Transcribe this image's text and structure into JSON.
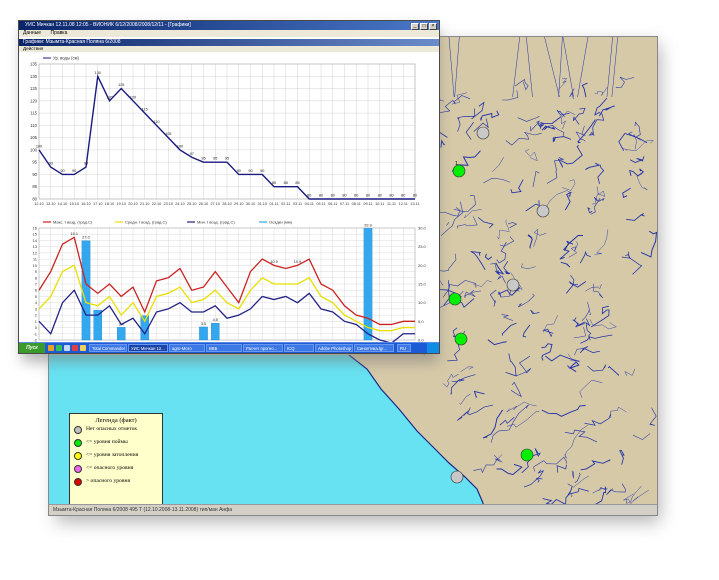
{
  "window": {
    "title": "УИС Мичкан 12.11.08 12:05 - ВИОНИК 6/12/2008/2008/12/11 - [Графики]",
    "menu": [
      "Данные",
      "Правка"
    ],
    "inner_title": "Графики: Мзымта-Красная Поляна 6/2008",
    "inner_menu": "Действия"
  },
  "legend": {
    "title": "Легенда (факт)",
    "items": [
      {
        "label": "Нет опасных отметок",
        "color": "#c0c0c0"
      },
      {
        "label": "<= уровня поймы",
        "color": "#00ee00"
      },
      {
        "label": "<= уровня затопления",
        "color": "#ffff00"
      },
      {
        "label": "<= опасного уровня",
        "color": "#ee66ee"
      },
      {
        "label": "> опасного уровня",
        "color": "#dd0000"
      }
    ]
  },
  "map_status": "Мзымта-Красная Поляна 6/2008 495 Т (12.10.2008-13.11.2008) тип/ман Анфа",
  "taskbar": {
    "start": "Пуск",
    "tasks": [
      "Total Commander",
      "УИС Мичкан 12...",
      "agro-Мото",
      "ВВБ",
      "Расчет прогно...",
      "ICQ",
      "Adobe Photoshop",
      "Синоптика.lgr...",
      "RU"
    ]
  },
  "colors": {
    "map_land": "#d6c9a8",
    "map_sea": "#66e2f2",
    "river": "#2233aa",
    "max_temp": "#cc2222",
    "mean_temp": "#e8e000",
    "min_temp": "#222288",
    "precip": "#33a8ee",
    "water_level": "#1a1a80"
  },
  "chart_data": [
    {
      "type": "line",
      "legend": [
        "Ур. воды (см)"
      ],
      "x": [
        "12.10",
        "13.10",
        "14.10",
        "15.10",
        "16.10",
        "17.10",
        "18.10",
        "19.10",
        "20.10",
        "21.10",
        "22.10",
        "23.10",
        "24.10",
        "25.10",
        "26.10",
        "27.10",
        "28.10",
        "29.10",
        "30.10",
        "31.10",
        "01.11",
        "02.11",
        "03.11",
        "04.11",
        "05.11",
        "06.11",
        "07.11",
        "08.11",
        "09.11",
        "10.11",
        "11.11",
        "12.11",
        "13.11"
      ],
      "ylim": [
        80,
        135
      ],
      "yticks": [
        80,
        85,
        90,
        95,
        100,
        105,
        110,
        115,
        120,
        125,
        130,
        135
      ],
      "series": [
        {
          "name": "Ур. воды (см)",
          "values": [
            100,
            93,
            90,
            90,
            93,
            130,
            120,
            125,
            120,
            115,
            110,
            105,
            100,
            97,
            95,
            95,
            95,
            90,
            90,
            90,
            85,
            85,
            85,
            80,
            80,
            80,
            80,
            80,
            80,
            80,
            80,
            80,
            80
          ]
        }
      ]
    },
    {
      "type": "line",
      "x": [
        "12.10",
        "13.10",
        "14.10",
        "15.10",
        "16.10",
        "17.10",
        "18.10",
        "19.10",
        "20.10",
        "21.10",
        "22.10",
        "23.10",
        "24.10",
        "25.10",
        "26.10",
        "27.10",
        "28.10",
        "29.10",
        "30.10",
        "31.10",
        "01.11",
        "02.11",
        "03.11",
        "04.11",
        "05.11",
        "06.11",
        "07.11",
        "08.11",
        "09.11",
        "10.11",
        "11.11",
        "12.11",
        "13.11"
      ],
      "legend": [
        "Макс. t возд. (град.С)",
        "Средн. t возд. (град.С)",
        "Мин. t возд. (град.С)",
        "Осадки (мм)"
      ],
      "ylim": [
        -2,
        16
      ],
      "yticks": [
        -2,
        -1,
        0,
        1,
        2,
        3,
        4,
        5,
        6,
        7,
        8,
        9,
        10,
        11,
        12,
        13,
        14,
        15,
        16
      ],
      "y2lim": [
        0,
        30
      ],
      "y2ticks": [
        0,
        5,
        10,
        15,
        20,
        25,
        30
      ],
      "series": [
        {
          "name": "Макс. t возд. (град.С)",
          "values": [
            6,
            9,
            13.4,
            14.5,
            7,
            5.5,
            7,
            5,
            6.5,
            2.5,
            7.5,
            8,
            9.5,
            6,
            6.5,
            9,
            6.5,
            4,
            9,
            11,
            10,
            9.5,
            10,
            11,
            7,
            6,
            3.5,
            2,
            1.5,
            0.5,
            0.5,
            1,
            1
          ]
        },
        {
          "name": "Средн. t возд. (град.С)",
          "values": [
            3,
            5,
            9,
            10,
            4,
            3.5,
            5,
            2,
            4,
            1,
            5,
            5.5,
            6.5,
            4,
            4.5,
            6,
            4,
            3,
            6,
            8,
            7,
            7,
            7,
            8,
            5,
            4,
            2,
            1,
            0,
            -0.5,
            -0.5,
            0,
            0
          ]
        },
        {
          "name": "Мин. t возд. (град.С)",
          "values": [
            1,
            -1,
            4,
            6,
            2,
            2,
            3.5,
            0.5,
            1.5,
            -1,
            2.5,
            3,
            4,
            2.5,
            2.5,
            3.5,
            1.5,
            2,
            3,
            5,
            4.5,
            5,
            4,
            5.5,
            3,
            2.5,
            1,
            0.5,
            -1,
            -2,
            -2.5,
            -1,
            -1
          ]
        },
        {
          "name": "Осадки (мм)",
          "axis": "right",
          "values": [
            0,
            0,
            0,
            0,
            26.6,
            8,
            0,
            3.4,
            0,
            6.5,
            0,
            0,
            0,
            0,
            3.5,
            4.5,
            0,
            0,
            0,
            0,
            0,
            0,
            0,
            0,
            0,
            0,
            0,
            0,
            29.9,
            0,
            0,
            0,
            0
          ]
        }
      ],
      "value_labels": [
        {
          "i": 3,
          "s": 0,
          "text": "15.1"
        },
        {
          "i": 4,
          "s": 3,
          "text": "27.0"
        },
        {
          "i": 28,
          "s": 3,
          "text": "29.9"
        },
        {
          "i": 20,
          "s": 0,
          "text": "10.9"
        },
        {
          "i": 22,
          "s": 0,
          "text": "10.9"
        },
        {
          "i": 7,
          "s": 3,
          "text": "3.4"
        },
        {
          "i": 14,
          "s": 3,
          "text": "3.5"
        },
        {
          "i": 15,
          "s": 3,
          "text": "4.5"
        }
      ]
    }
  ]
}
